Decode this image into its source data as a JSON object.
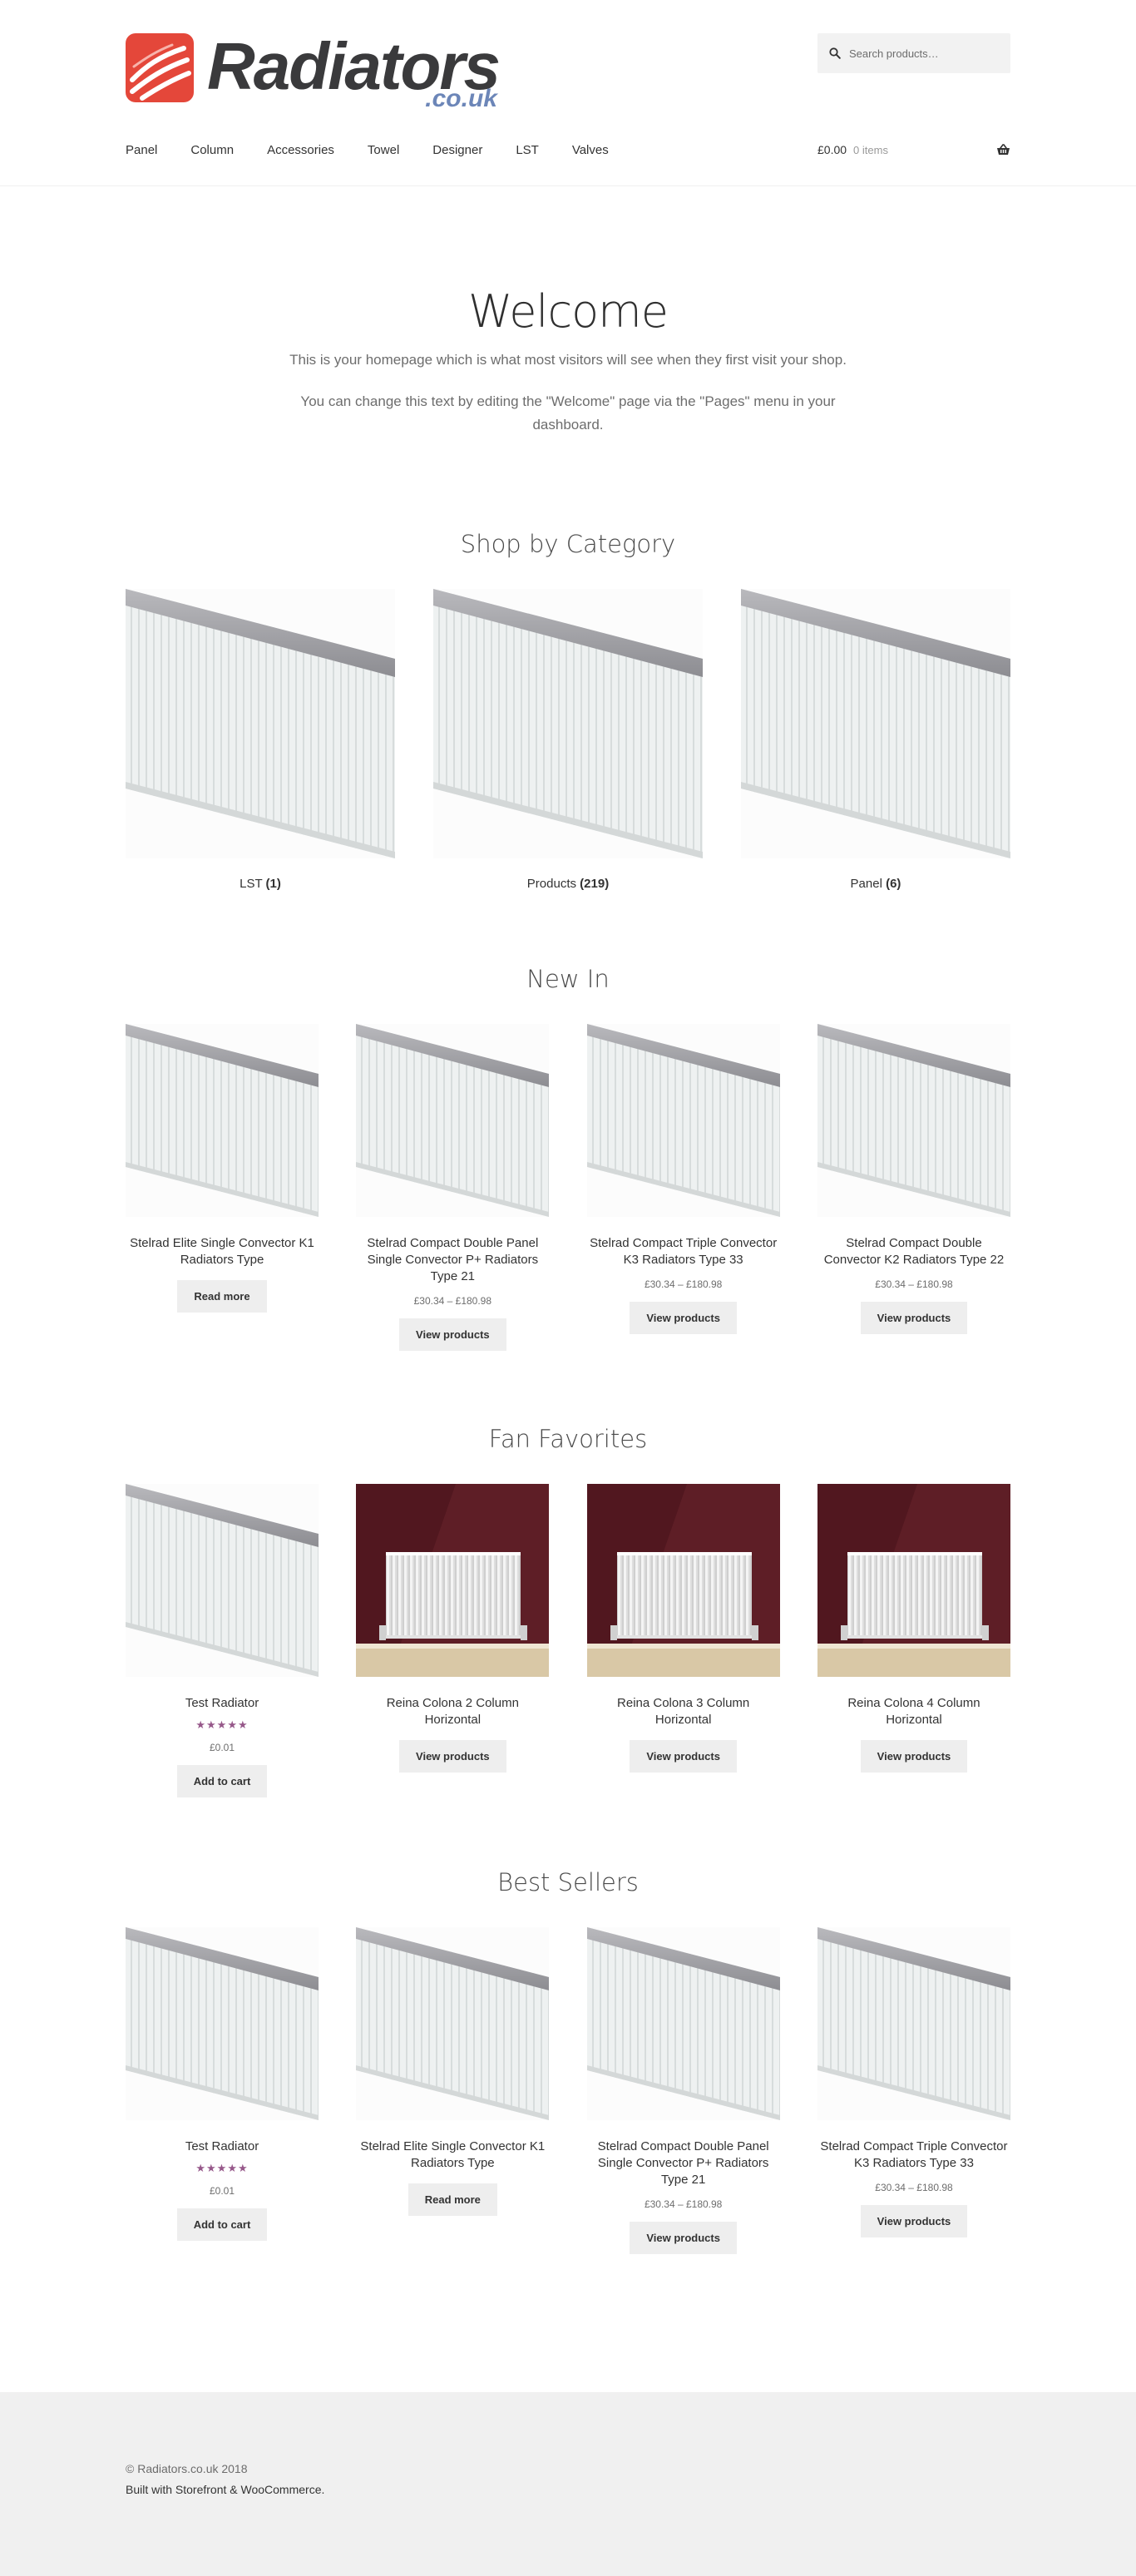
{
  "brand": {
    "name": "Radiators",
    "tld": ".co.uk",
    "colors": {
      "logo_red": "#e4473a",
      "logo_dark": "#3a3a3c",
      "tld_blue": "#6c86b8"
    }
  },
  "search": {
    "placeholder": "Search products…",
    "icon": "search-icon"
  },
  "nav": {
    "items": [
      {
        "label": "Panel"
      },
      {
        "label": "Column"
      },
      {
        "label": "Accessories"
      },
      {
        "label": "Towel"
      },
      {
        "label": "Designer"
      },
      {
        "label": "LST"
      },
      {
        "label": "Valves"
      }
    ]
  },
  "cart": {
    "total": "£0.00",
    "count": "0 items",
    "icon": "basket-icon"
  },
  "welcome": {
    "title": "Welcome",
    "line1": "This is your homepage which is what most visitors will see when they first visit your shop.",
    "line2": "You can change this text by editing the \"Welcome\" page via the \"Pages\" menu in your dashboard."
  },
  "shop_by_category": {
    "title": "Shop by Category",
    "items": [
      {
        "name": "LST",
        "count": "(1)"
      },
      {
        "name": "Products",
        "count": "(219)"
      },
      {
        "name": "Panel",
        "count": "(6)"
      }
    ]
  },
  "new_in": {
    "title": "New In",
    "items": [
      {
        "title": "Stelrad Elite Single Convector K1 Radiators Type",
        "price": "",
        "button": "Read more"
      },
      {
        "title": "Stelrad Compact Double Panel Single Convector P+ Radiators Type 21",
        "price": "£30.34 – £180.98",
        "button": "View products"
      },
      {
        "title": "Stelrad Compact Triple Convector K3 Radiators Type 33",
        "price": "£30.34 – £180.98",
        "button": "View products"
      },
      {
        "title": "Stelrad Compact Double Convector K2 Radiators Type 22",
        "price": "£30.34 – £180.98",
        "button": "View products"
      }
    ]
  },
  "fan_favorites": {
    "title": "Fan Favorites",
    "items": [
      {
        "title": "Test Radiator",
        "rating": 5,
        "stars": "★★★★★",
        "price": "£0.01",
        "button": "Add to cart"
      },
      {
        "title": "Reina Colona 2 Column Horizontal",
        "price": "",
        "button": "View products"
      },
      {
        "title": "Reina Colona 3 Column Horizontal",
        "price": "",
        "button": "View products"
      },
      {
        "title": "Reina Colona 4 Column Horizontal",
        "price": "",
        "button": "View products"
      }
    ]
  },
  "best_sellers": {
    "title": "Best Sellers",
    "items": [
      {
        "title": "Test Radiator",
        "rating": 5,
        "stars": "★★★★★",
        "price": "£0.01",
        "button": "Add to cart"
      },
      {
        "title": "Stelrad Elite Single Convector K1 Radiators Type",
        "price": "",
        "button": "Read more"
      },
      {
        "title": "Stelrad Compact Double Panel Single Convector P+ Radiators Type 21",
        "price": "£30.34 – £180.98",
        "button": "View products"
      },
      {
        "title": "Stelrad Compact Triple Convector K3 Radiators Type 33",
        "price": "£30.34 – £180.98",
        "button": "View products"
      }
    ]
  },
  "footer": {
    "copyright": "© Radiators.co.uk 2018",
    "credit": "Built with Storefront & WooCommerce."
  },
  "colors": {
    "star": "#96588a",
    "button_bg": "#eeeeee",
    "footer_bg": "#f0f0f0"
  }
}
